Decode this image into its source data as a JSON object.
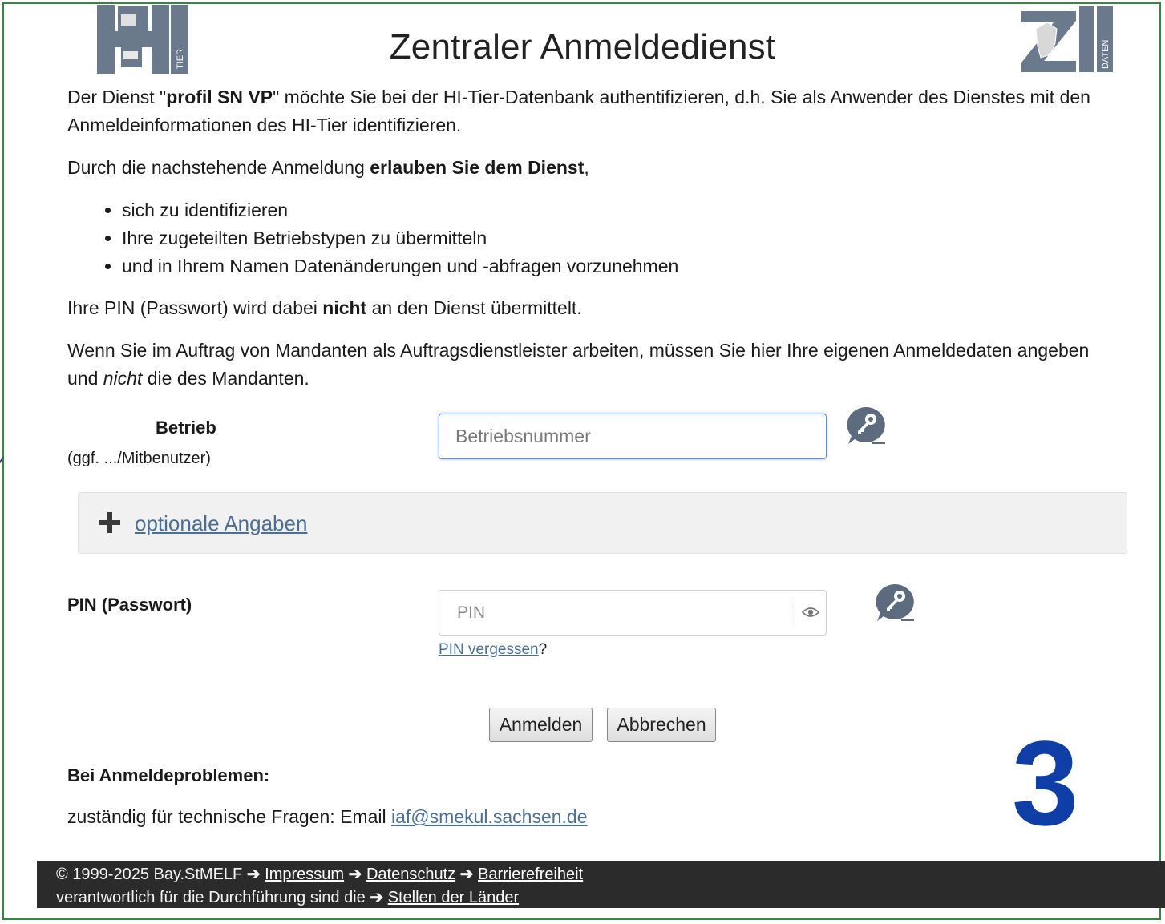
{
  "header": {
    "title": "Zentraler Anmeldedienst",
    "logo_left_text": "TIER",
    "logo_right_text": "DATEN"
  },
  "intro": {
    "p1_pre": "Der Dienst \"",
    "p1_service": "profil SN VP",
    "p1_post": "\" möchte Sie bei der HI-Tier-Datenbank authentifizieren, d.h. Sie als Anwender des Dienstes mit den Anmeldeinformationen des HI-Tier identifizieren.",
    "p2_pre": "Durch die nachstehende Anmeldung ",
    "p2_bold": "erlauben Sie dem Dienst",
    "p2_post": ",",
    "list": [
      "sich zu identifizieren",
      "Ihre zugeteilten Betriebstypen zu übermitteln",
      "und in Ihrem Namen Datenänderungen und -abfragen vorzunehmen"
    ],
    "p3_pre": "Ihre PIN (Passwort) wird dabei ",
    "p3_bold": "nicht",
    "p3_post": " an den Dienst übermittelt.",
    "p4_pre": "Wenn Sie im Auftrag von Mandanten als Auftragsdienstleister arbeiten, müssen Sie hier Ihre eigenen Anmeldedaten angeben und ",
    "p4_italic": "nicht",
    "p4_post": " die des Mandanten."
  },
  "form": {
    "betrieb_label": "Betrieb",
    "betrieb_sublabel": "(ggf. .../Mitbenutzer)",
    "betrieb_placeholder": "Betriebsnummer",
    "betrieb_value": "",
    "optional_label": "optionale Angaben",
    "pin_label": "PIN (Passwort)",
    "pin_placeholder": "PIN",
    "pin_value": "",
    "pin_forgot": "PIN vergessen",
    "pin_forgot_suffix": "?",
    "login_button": "Anmelden",
    "cancel_button": "Abbrechen"
  },
  "support": {
    "heading": "Bei Anmeldeproblemen:",
    "contact_text": "zuständig für technische Fragen: Email ",
    "email": "iaf@smekul.sachsen.de"
  },
  "overlay_number": "3",
  "footer": {
    "copyright": "© 1999-2025 Bay.StMELF",
    "impressum": "Impressum",
    "datenschutz": "Datenschutz",
    "barrierefreiheit": "Barrierefreiheit",
    "line2_text": "verantwortlich für die Durchführung sind die",
    "stellen": "Stellen der Länder"
  },
  "colors": {
    "link": "#4a6f97",
    "footer_bg": "#2b2b2b",
    "overlay_number": "#0f3fa6",
    "frame_border": "#2f8a3e",
    "input_focus_border": "#5b8ee0"
  },
  "icons": [
    "hi-tier-logo-icon",
    "zi-daten-logo-icon",
    "key-icon",
    "plus-icon",
    "eye-icon",
    "arrow-right-icon"
  ]
}
